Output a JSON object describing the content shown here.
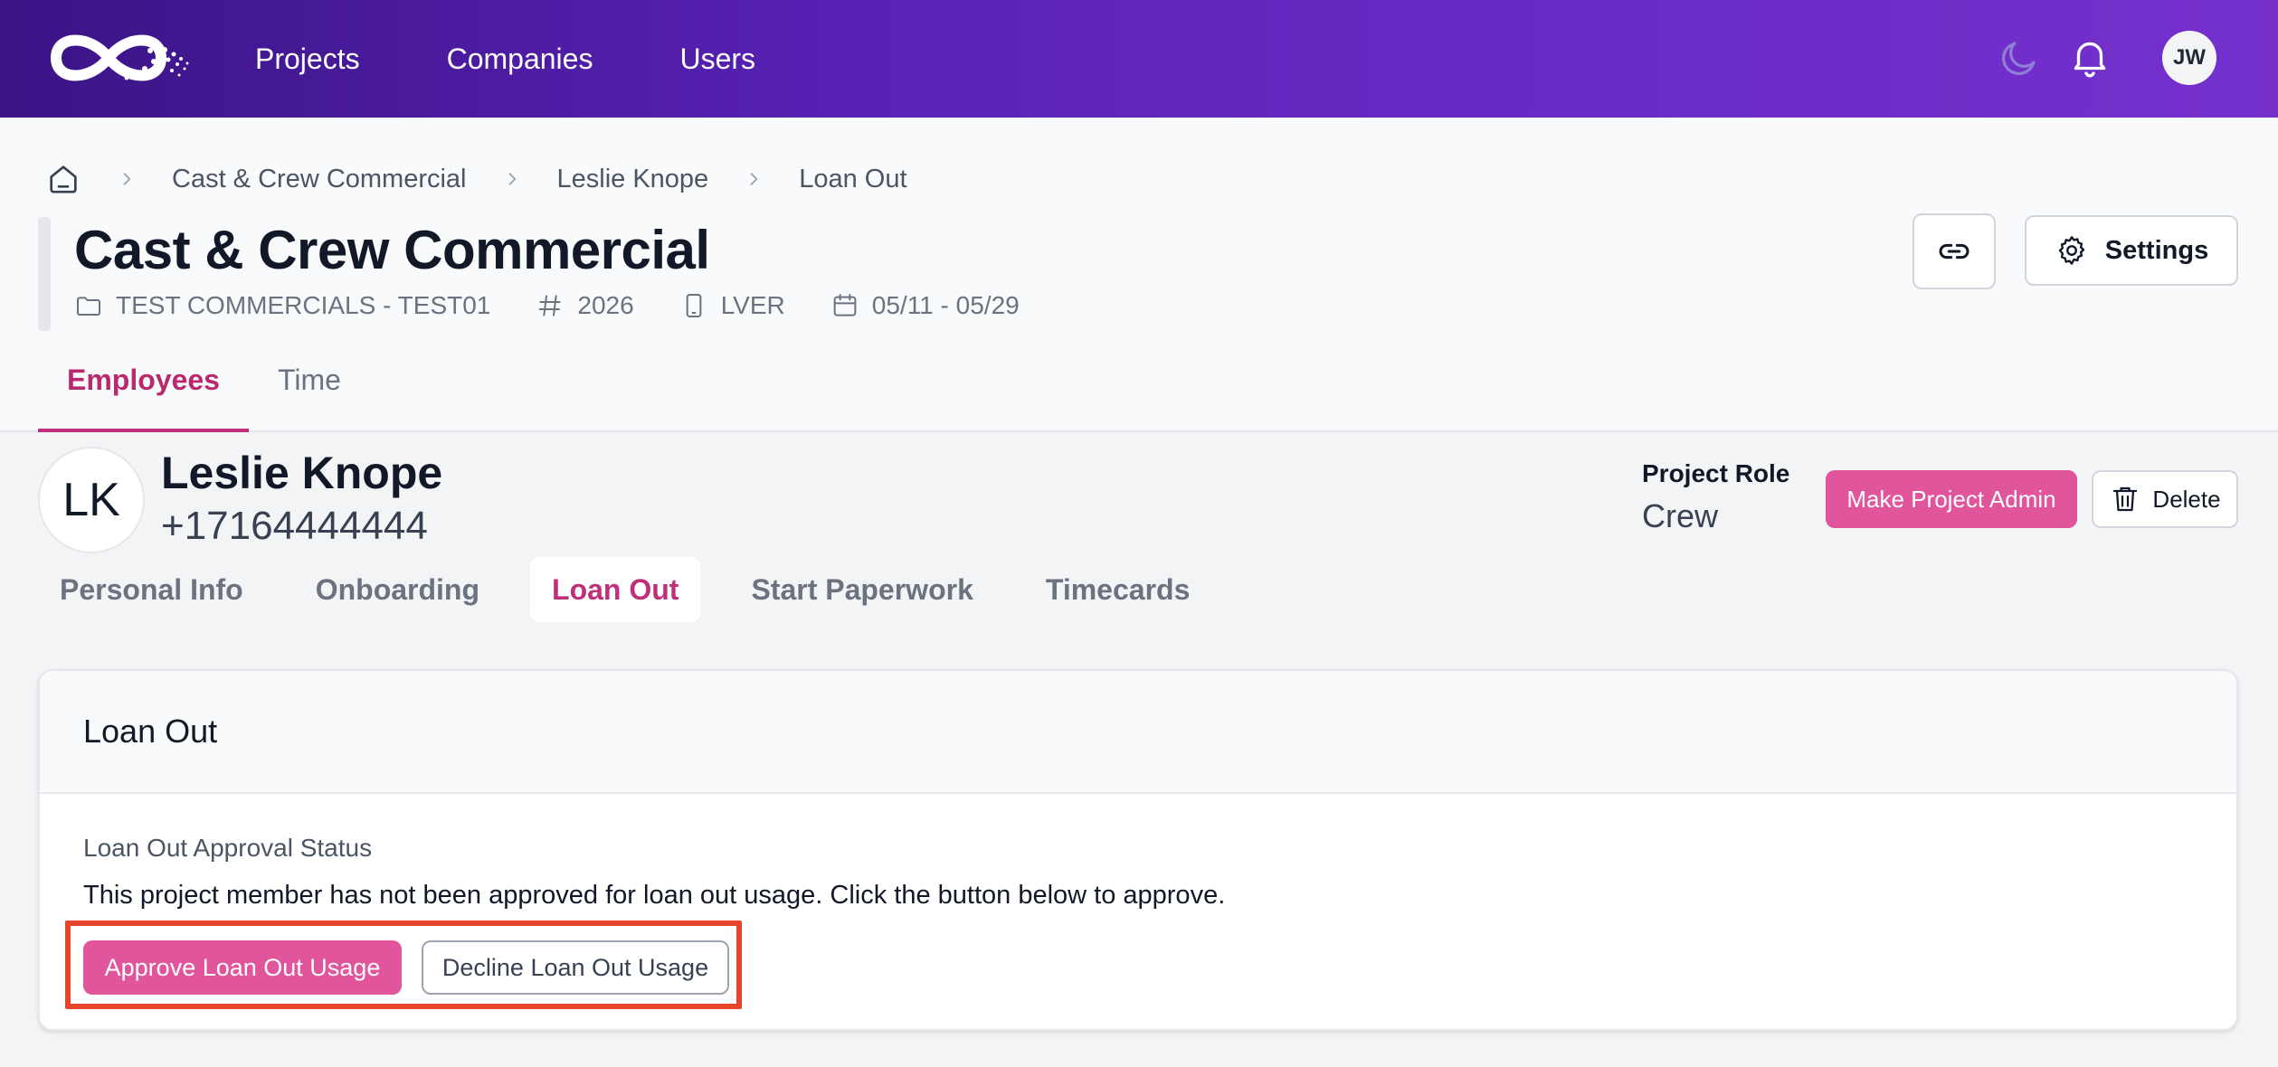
{
  "nav": {
    "logo": "brand-logo",
    "links": [
      "Projects",
      "Companies",
      "Users"
    ],
    "user_initials": "JW",
    "icons": [
      "moon-icon",
      "bell-icon"
    ]
  },
  "breadcrumb": {
    "items": [
      "Cast & Crew Commercial",
      "Leslie Knope",
      "Loan Out"
    ]
  },
  "project": {
    "title": "Cast & Crew Commercial",
    "company": "TEST COMMERCIALS - TEST01",
    "number": "2026",
    "device_code": "LVER",
    "dates": "05/11 - 05/29",
    "settings_label": "Settings",
    "tabs": [
      "Employees",
      "Time"
    ],
    "active_tab": "Employees"
  },
  "member": {
    "initials": "LK",
    "name": "Leslie Knope",
    "phone": "+17164444444",
    "role_label": "Project Role",
    "role_value": "Crew",
    "make_admin_label": "Make Project Admin",
    "delete_label": "Delete",
    "tabs": [
      "Personal Info",
      "Onboarding",
      "Loan Out",
      "Start Paperwork",
      "Timecards"
    ],
    "active_tab": "Loan Out"
  },
  "loan_out": {
    "card_title": "Loan Out",
    "status_label": "Loan Out Approval Status",
    "status_text": "This project member has not been approved for loan out usage. Click the button below to approve.",
    "approve_label": "Approve Loan Out Usage",
    "decline_label": "Decline Loan Out Usage"
  },
  "colors": {
    "nav_gradient_start": "#3b1485",
    "nav_gradient_end": "#7530cc",
    "accent": "#e0559b",
    "active_tab": "#c0307a",
    "highlight_border": "#e8432b"
  }
}
